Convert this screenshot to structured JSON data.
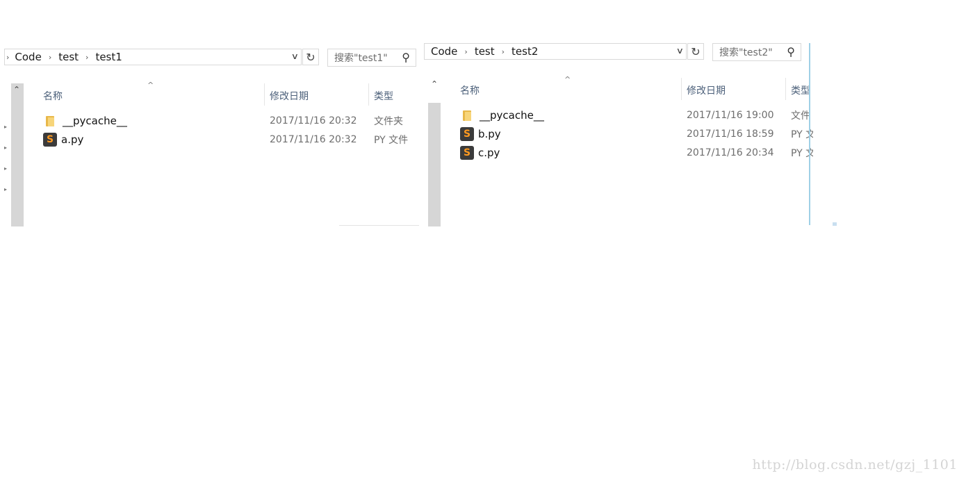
{
  "panels": [
    {
      "breadcrumb": [
        "Code",
        "test",
        "test1"
      ],
      "search_placeholder": "搜索\"test1\"",
      "columns": {
        "name": "名称",
        "date": "修改日期",
        "type": "类型"
      },
      "files": [
        {
          "icon": "folder-icon",
          "name": "__pycache__",
          "date": "2017/11/16 20:32",
          "type": "文件夹"
        },
        {
          "icon": "python-file-icon",
          "name": "a.py",
          "date": "2017/11/16 20:32",
          "type": "PY 文件"
        }
      ]
    },
    {
      "breadcrumb": [
        "Code",
        "test",
        "test2"
      ],
      "search_placeholder": "搜索\"test2\"",
      "columns": {
        "name": "名称",
        "date": "修改日期",
        "type": "类型"
      },
      "files": [
        {
          "icon": "folder-icon",
          "name": "__pycache__",
          "date": "2017/11/16 19:00",
          "type": "文件"
        },
        {
          "icon": "python-file-icon",
          "name": "b.py",
          "date": "2017/11/16 18:59",
          "type": "PY 文"
        },
        {
          "icon": "python-file-icon",
          "name": "c.py",
          "date": "2017/11/16 20:34",
          "type": "PY 文"
        }
      ]
    }
  ],
  "watermark": "http://blog.csdn.net/gzj_1101",
  "colors": {
    "folder": "#e8b84a",
    "py_icon_bg": "#3b3b3b",
    "py_icon_fg": "#ff9a1f",
    "header_text": "#4c607a"
  }
}
